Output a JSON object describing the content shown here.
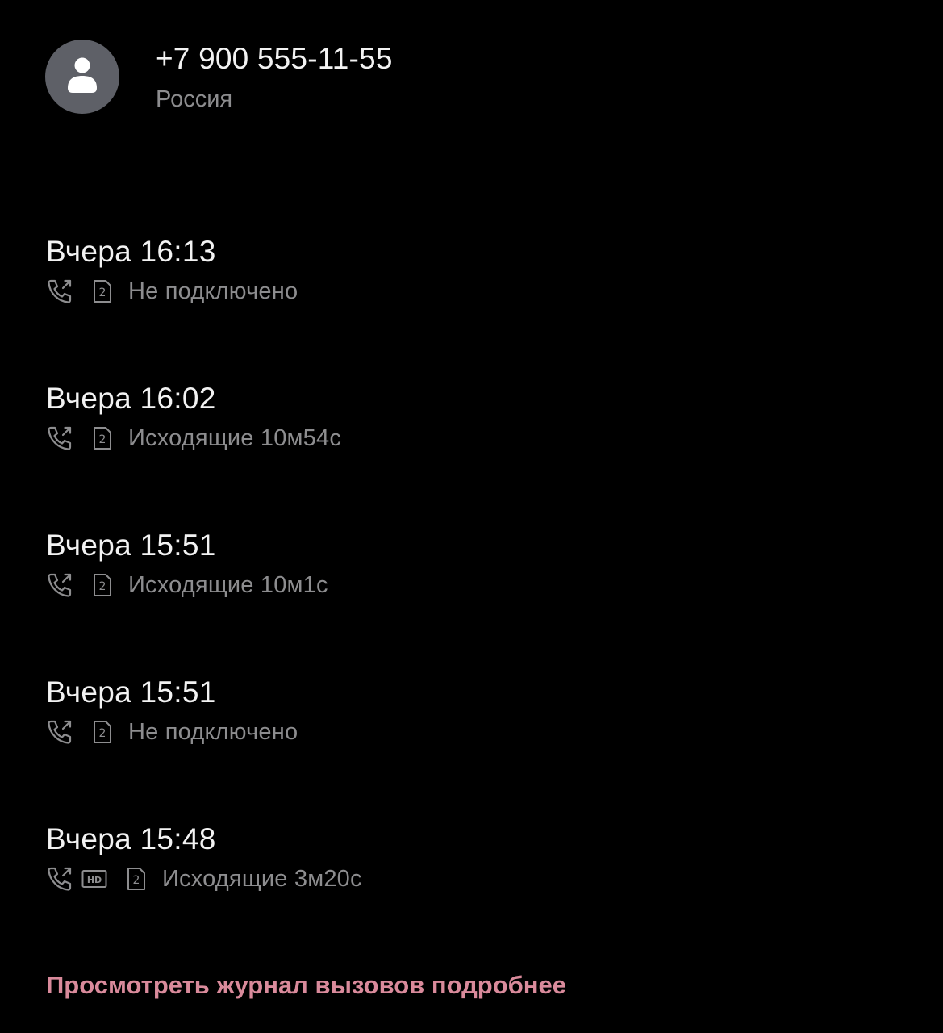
{
  "contact": {
    "phone": "+7 900 555-11-55",
    "country": "Россия",
    "avatar_icon": "person-icon",
    "avatar_color": "#5e6067"
  },
  "calls": [
    {
      "time": "Вчера 16:13",
      "status": "Не подключено",
      "hd": false,
      "sim": "2",
      "direction_icon": "outgoing-call-icon"
    },
    {
      "time": "Вчера 16:02",
      "status": "Исходящие 10м54с",
      "hd": false,
      "sim": "2",
      "direction_icon": "outgoing-call-icon"
    },
    {
      "time": "Вчера 15:51",
      "status": "Исходящие 10м1с",
      "hd": false,
      "sim": "2",
      "direction_icon": "outgoing-call-icon"
    },
    {
      "time": "Вчера 15:51",
      "status": "Не подключено",
      "hd": false,
      "sim": "2",
      "direction_icon": "outgoing-call-icon"
    },
    {
      "time": "Вчера 15:48",
      "status": "Исходящие 3м20с",
      "hd": true,
      "hd_label": "HD",
      "sim": "2",
      "direction_icon": "outgoing-call-icon"
    }
  ],
  "footer": {
    "more_link": "Просмотреть журнал вызовов подробнее",
    "accent_color": "#d98a9b"
  }
}
